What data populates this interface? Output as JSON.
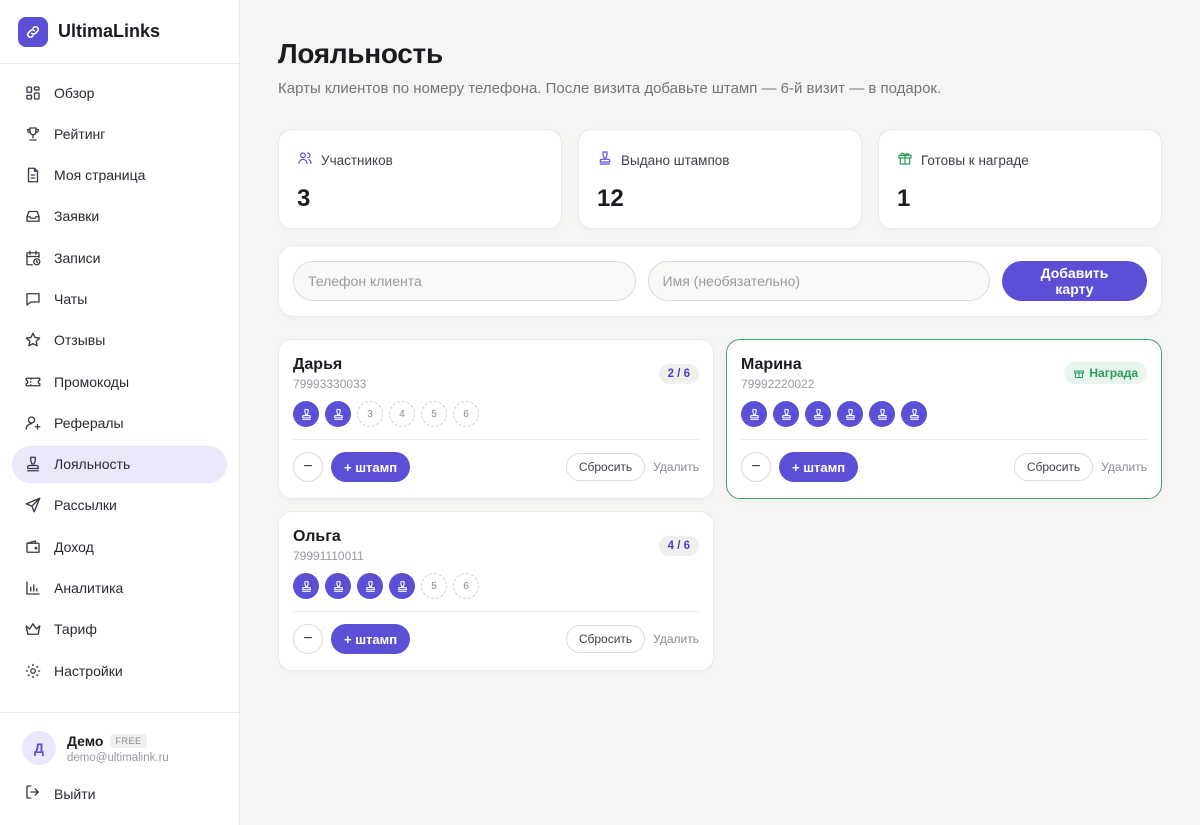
{
  "app": {
    "name": "UltimaLinks",
    "accent": "#5b4fd6",
    "reward_color": "#3fa56b"
  },
  "sidebar": {
    "items": [
      {
        "label": "Обзор",
        "icon": "dashboard-icon"
      },
      {
        "label": "Рейтинг",
        "icon": "trophy-icon"
      },
      {
        "label": "Моя страница",
        "icon": "file-icon"
      },
      {
        "label": "Заявки",
        "icon": "inbox-icon"
      },
      {
        "label": "Записи",
        "icon": "calendar-clock-icon"
      },
      {
        "label": "Чаты",
        "icon": "chat-icon"
      },
      {
        "label": "Отзывы",
        "icon": "star-icon"
      },
      {
        "label": "Промокоды",
        "icon": "ticket-icon"
      },
      {
        "label": "Рефералы",
        "icon": "user-plus-icon"
      },
      {
        "label": "Лояльность",
        "icon": "stamp-icon",
        "active": true
      },
      {
        "label": "Рассылки",
        "icon": "send-icon"
      },
      {
        "label": "Доход",
        "icon": "wallet-icon"
      },
      {
        "label": "Аналитика",
        "icon": "bar-chart-icon"
      },
      {
        "label": "Тариф",
        "icon": "crown-icon"
      },
      {
        "label": "Настройки",
        "icon": "gear-icon"
      }
    ],
    "user": {
      "initial": "Д",
      "name": "Демо",
      "plan": "FREE",
      "email": "demo@ultimalink.ru"
    },
    "logout_label": "Выйти"
  },
  "page": {
    "title": "Лояльность",
    "subtitle": "Карты клиентов по номеру телефона. После визита добавьте штамп — 6-й визит — в подарок."
  },
  "stats": [
    {
      "label": "Участников",
      "value": "3",
      "icon": "users-icon"
    },
    {
      "label": "Выдано штампов",
      "value": "12",
      "icon": "stamp-icon"
    },
    {
      "label": "Готовы к награде",
      "value": "1",
      "icon": "gift-icon"
    }
  ],
  "form": {
    "phone_placeholder": "Телефон клиента",
    "name_placeholder": "Имя (необязательно)",
    "submit_label": "Добавить карту"
  },
  "cards": [
    {
      "name": "Дарья",
      "phone": "79993330033",
      "stamps": 2,
      "total": 6,
      "progress": "2 / 6",
      "reward": false
    },
    {
      "name": "Марина",
      "phone": "79992220022",
      "stamps": 6,
      "total": 6,
      "progress": "6 / 6",
      "reward": true,
      "reward_label": "Награда"
    },
    {
      "name": "Ольга",
      "phone": "79991110011",
      "stamps": 4,
      "total": 6,
      "progress": "4 / 6",
      "reward": false
    }
  ],
  "card_labels": {
    "minus": "−",
    "add_stamp": "+ штамп",
    "reset": "Сбросить",
    "delete": "Удалить"
  }
}
